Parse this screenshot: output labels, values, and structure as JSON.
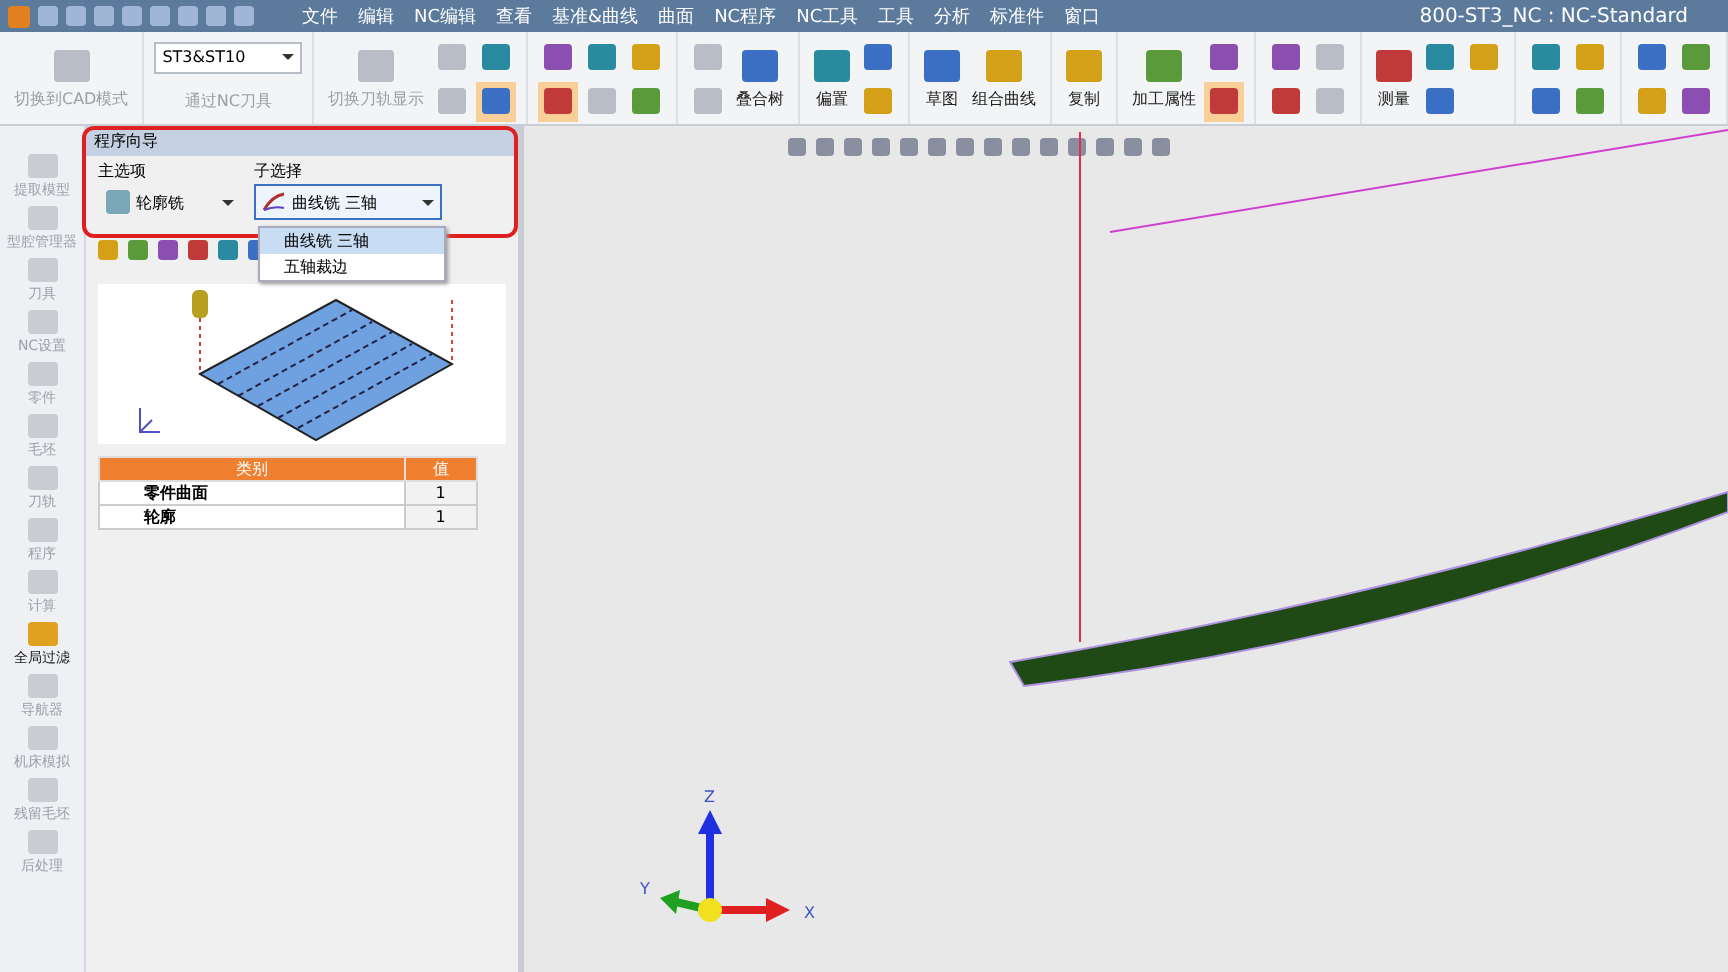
{
  "title_bar": {
    "menus": [
      "文件",
      "编辑",
      "NC编辑",
      "查看",
      "基准&曲线",
      "曲面",
      "NC程序",
      "NC工具",
      "工具",
      "分析",
      "标准件",
      "窗口"
    ],
    "title": "800-ST3_NC : NC-Standard"
  },
  "ribbon": {
    "groups": [
      [
        {
          "kind": "large",
          "label": "切换到CAD模式",
          "disabled": true
        }
      ],
      [
        {
          "kind": "combo",
          "value": "ST3&ST10"
        },
        {
          "kind": "small",
          "label": "通过NC刀具",
          "disabled": true
        }
      ],
      [
        {
          "kind": "large",
          "label": "切换刀轨显示",
          "disabled": true
        },
        {
          "kind": "icon",
          "selected": false,
          "disabled": true
        },
        {
          "kind": "icon",
          "selected": false,
          "disabled": true
        },
        {
          "kind": "icon",
          "selected": false,
          "disabled": false
        },
        {
          "kind": "icon",
          "selected": true,
          "disabled": false
        }
      ],
      [
        {
          "kind": "icon",
          "selected": false,
          "disabled": false
        },
        {
          "kind": "icon",
          "selected": true,
          "disabled": false
        },
        {
          "kind": "icon",
          "selected": false,
          "disabled": false
        },
        {
          "kind": "icon",
          "selected": false,
          "disabled": true
        },
        {
          "kind": "icon",
          "selected": false,
          "disabled": false
        },
        {
          "kind": "icon",
          "selected": false,
          "disabled": false
        }
      ],
      [
        {
          "kind": "icon",
          "selected": false,
          "disabled": true
        },
        {
          "kind": "icon",
          "selected": false,
          "disabled": true
        },
        {
          "kind": "large",
          "label": "叠合树",
          "disabled": false
        }
      ],
      [
        {
          "kind": "large",
          "label": "偏置",
          "disabled": false
        },
        {
          "kind": "icon",
          "selected": false,
          "disabled": false
        },
        {
          "kind": "icon",
          "selected": false,
          "disabled": false
        }
      ],
      [
        {
          "kind": "large",
          "label": "草图",
          "disabled": false
        },
        {
          "kind": "large",
          "label": "组合曲线",
          "disabled": false
        }
      ],
      [
        {
          "kind": "large",
          "label": "复制",
          "disabled": false
        }
      ],
      [
        {
          "kind": "large",
          "label": "加工属性",
          "disabled": false
        },
        {
          "kind": "icon",
          "selected": false,
          "disabled": false
        },
        {
          "kind": "icon",
          "selected": true,
          "disabled": false
        }
      ],
      [
        {
          "kind": "icon",
          "selected": false,
          "disabled": false
        },
        {
          "kind": "icon",
          "selected": false,
          "disabled": false
        },
        {
          "kind": "icon",
          "selected": false,
          "disabled": true
        },
        {
          "kind": "icon",
          "selected": false,
          "disabled": true
        }
      ],
      [
        {
          "kind": "large",
          "label": "测量",
          "disabled": false
        },
        {
          "kind": "icon",
          "selected": false,
          "disabled": false
        },
        {
          "kind": "icon",
          "selected": false,
          "disabled": false
        },
        {
          "kind": "icon",
          "selected": false,
          "disabled": false
        }
      ],
      [
        {
          "kind": "icon",
          "selected": false,
          "disabled": false
        },
        {
          "kind": "icon",
          "selected": false,
          "disabled": false
        },
        {
          "kind": "icon",
          "selected": false,
          "disabled": false
        },
        {
          "kind": "icon",
          "selected": false,
          "disabled": false
        }
      ],
      [
        {
          "kind": "icon",
          "selected": false,
          "disabled": false
        },
        {
          "kind": "icon",
          "selected": false,
          "disabled": false
        },
        {
          "kind": "icon",
          "selected": false,
          "disabled": false
        },
        {
          "kind": "icon",
          "selected": false,
          "disabled": false
        }
      ]
    ]
  },
  "sidebar": {
    "items": [
      {
        "label": "提取模型",
        "disabled": true
      },
      {
        "label": "型腔管理器",
        "disabled": true
      },
      {
        "label": "刀具",
        "disabled": true
      },
      {
        "label": "NC设置",
        "disabled": true
      },
      {
        "label": "零件",
        "disabled": true
      },
      {
        "label": "毛坯",
        "disabled": true
      },
      {
        "label": "刀轨",
        "disabled": true
      },
      {
        "label": "程序",
        "disabled": true
      },
      {
        "label": "计算",
        "disabled": true
      },
      {
        "label": "全局过滤",
        "disabled": false
      },
      {
        "label": "导航器",
        "disabled": true
      },
      {
        "label": "机床模拟",
        "disabled": true
      },
      {
        "label": "残留毛坯",
        "disabled": true
      },
      {
        "label": "后处理",
        "disabled": true
      }
    ]
  },
  "wizard": {
    "title": "程序向导",
    "main": {
      "label": "主选项",
      "value": "轮廓铣"
    },
    "sub": {
      "label": "子选择",
      "value": "曲线铣 三轴",
      "expanded": true,
      "options": [
        {
          "label": "曲线铣 三轴",
          "selected": true
        },
        {
          "label": "五轴裁边",
          "selected": false
        }
      ]
    },
    "table": {
      "columns": [
        "类别",
        "值"
      ],
      "rows": [
        [
          "零件曲面",
          "1"
        ],
        [
          "轮廓",
          "1"
        ]
      ]
    }
  },
  "viewport": {
    "axes": {
      "x": "X",
      "y": "Y",
      "z": "Z"
    }
  }
}
